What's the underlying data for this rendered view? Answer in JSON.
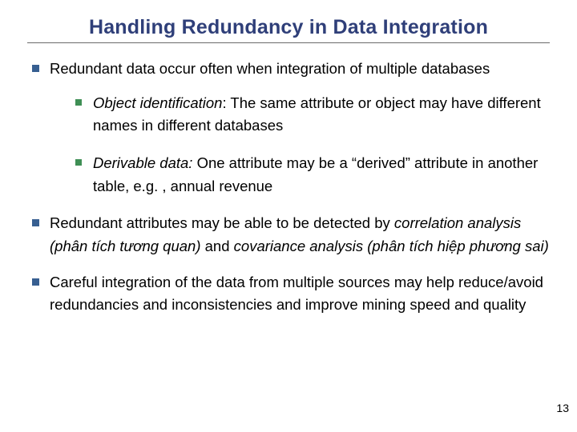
{
  "title": "Handling Redundancy in Data Integration",
  "bullets": {
    "b1": {
      "text": "Redundant data occur often when integration of multiple databases",
      "sub": {
        "s1": {
          "lead": "Object identification",
          "rest": ":  The same attribute or object may have different names in different databases"
        },
        "s2": {
          "lead": "Derivable data:",
          "rest": " One attribute may be a “derived” attribute in another table, e.g. , annual revenue"
        }
      }
    },
    "b2": {
      "pre": "Redundant attributes may be able to be detected by ",
      "corr": "correlation analysis  (phân tích tương quan)",
      "mid": " and ",
      "cov": "covariance analysis  (phân tích hiệp phương sai)"
    },
    "b3": {
      "text": "Careful integration of the data from multiple sources may help reduce/avoid redundancies and inconsistencies and improve mining speed and quality"
    }
  },
  "page_number": "13"
}
